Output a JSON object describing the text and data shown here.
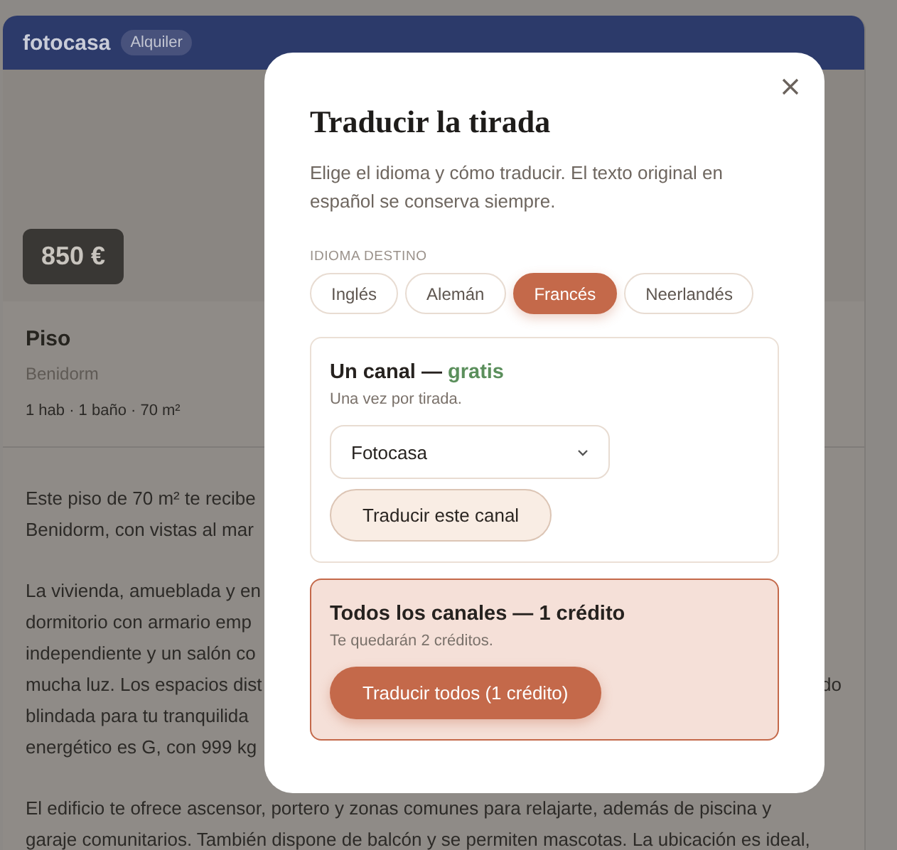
{
  "header": {
    "logo": "fotocasa",
    "badge": "Alquiler"
  },
  "listing": {
    "price": "850 €",
    "type": "Piso",
    "location": "Benidorm",
    "features": "1 hab · 1 baño · 70 m²",
    "paragraphs": [
      {
        "lines": [
          {
            "text": "Este piso de 70 m² te recibe"
          },
          {
            "text": "Benidorm, con vistas al mar"
          }
        ]
      },
      {
        "lines": [
          {
            "text": "La vivienda, amueblada y en"
          },
          {
            "text": "dormitorio con armario emp"
          },
          {
            "text": "independiente y un salón co"
          },
          {
            "text": "mucha luz. Los espacios dist",
            "right": "do"
          },
          {
            "text": "blindada para tu tranquilida"
          },
          {
            "text": "energético es G, con 999 kg"
          }
        ]
      },
      {
        "lines": [
          {
            "text": "El edificio te ofrece ascensor, portero y zonas comunes para relajarte, además de piscina y"
          },
          {
            "text": "garaje comunitarios. También dispone de balcón y se permiten mascotas. La ubicación es ideal,"
          }
        ]
      }
    ]
  },
  "modal": {
    "title": "Traducir la tirada",
    "description": "Elige el idioma y cómo traducir. El texto original en español se conserva siempre.",
    "language_label": "IDIOMA DESTINO",
    "languages": [
      {
        "label": "Inglés",
        "selected": false
      },
      {
        "label": "Alemán",
        "selected": false
      },
      {
        "label": "Francés",
        "selected": true
      },
      {
        "label": "Neerlandés",
        "selected": false
      }
    ],
    "options": [
      {
        "kind": "free",
        "title": "Un canal —",
        "price": "gratis",
        "note": "Una vez por tirada.",
        "select": {
          "value": "Fotocasa"
        },
        "button": "Traducir este canal"
      },
      {
        "kind": "paid",
        "title": "Todos los canales —",
        "price": "1 crédito",
        "note": "Te quedarán 2 créditos.",
        "button": "Traducir todos (1 crédito)"
      }
    ]
  }
}
